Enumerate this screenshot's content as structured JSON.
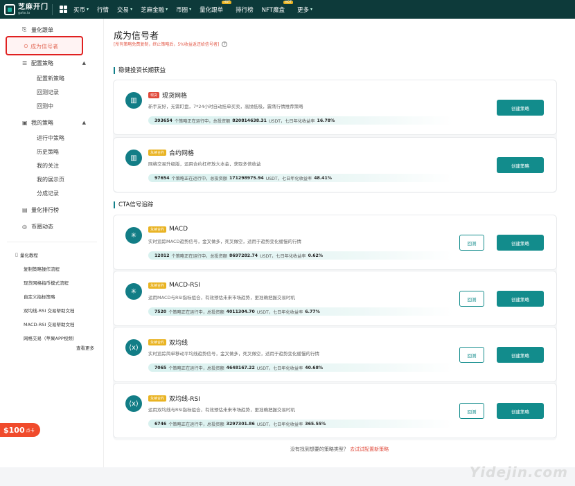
{
  "nav": {
    "logo_main": "芝麻开门",
    "logo_sub": "gate.io",
    "items": [
      {
        "label": "买币",
        "caret": true
      },
      {
        "label": "行情",
        "caret": false
      },
      {
        "label": "交易",
        "caret": true
      },
      {
        "label": "芝麻金融",
        "caret": true
      },
      {
        "label": "币圈",
        "caret": true
      },
      {
        "label": "量化跟单",
        "caret": false,
        "hot": "HOT"
      },
      {
        "label": "排行榜",
        "caret": false
      },
      {
        "label": "NFT魔盒",
        "caret": false,
        "hot": "HOT"
      },
      {
        "label": "更多",
        "caret": true
      }
    ]
  },
  "sidebar": {
    "quant_follow": "量化跟单",
    "become_signal": "成为信号者",
    "config_strategy": "配置策略",
    "config_subs": [
      "配置新策略",
      "回测记录",
      "回测中"
    ],
    "my_strategy": "我的策略",
    "my_subs": [
      "进行中策略",
      "历史策略",
      "我的关注",
      "我的展示页",
      "分成记录"
    ],
    "quant_rank": "量化排行榜",
    "coin_news": "币圈动态",
    "tutorial_head": "量化教程",
    "tutorials": [
      "复制策略操作流程",
      "现货网格指币模式流程",
      "自定义指标策略",
      "双均线-RSI 交易帮助文档",
      "MACD-RSI 交易帮助文档",
      "网格交易（苹果APP视频）"
    ],
    "more": "查看更多",
    "promo_amount": "$100",
    "promo_label": "点卡"
  },
  "main": {
    "title": "成为信号者",
    "subtitle": "[所有策略免费复制，终止策略后，5%收益返还给信号者]",
    "section1": "稳健投资长期获益",
    "section2": "CTA信号追踪",
    "create_label": "创建策略",
    "backtest_label": "回测",
    "footer_text": "没有找到想要的策略类型？",
    "footer_link": "去试试配置新策略",
    "cards": [
      {
        "tag": "现货",
        "title": "现货网格",
        "desc": "新手友好，无需盯盘，7*24小时自动挂单买卖，高抛低吸，震荡行情推荐策略",
        "count": "393654",
        "amount": "820814638.31",
        "rate": "16.78%"
      },
      {
        "tag": "永续合约",
        "title": "合约网格",
        "desc": "网格交易升级版，运用合约杠杆放大本金，获取多倍收益",
        "count": "97654",
        "amount": "171298975.94",
        "rate": "48.41%"
      },
      {
        "tag": "永续合约",
        "title": "MACD",
        "desc": "实时追踪MACD趋势信号，金叉做多，死叉做空，适用于趋势变化缓慢的行情",
        "count": "12012",
        "amount": "8697282.74",
        "rate": "0.62%"
      },
      {
        "tag": "永续合约",
        "title": "MACD-RSI",
        "desc": "运用MACD与RSI指标组合，有效预估未来市场趋势，更准确把握交易时机",
        "count": "7520",
        "amount": "4011304.70",
        "rate": "6.77%"
      },
      {
        "tag": "永续合约",
        "title": "双均线",
        "desc": "实时追踪简单移动平均线趋势信号，金叉做多，死叉做空，适用于趋势变化缓慢的行情",
        "count": "7065",
        "amount": "4648167.22",
        "rate": "40.68%"
      },
      {
        "tag": "永续合约",
        "title": "双均线-RSI",
        "desc": "运用双均线与RSI指标组合，有效预估未来市场趋势，更准确把握交易时机",
        "count": "6746",
        "amount": "3297301.86",
        "rate": "365.55%"
      }
    ],
    "stat_t1": "个策略正在运行中，总投资额",
    "stat_t2": "USDT，七日年化收益率",
    "watermark": "Yidejin.com"
  }
}
